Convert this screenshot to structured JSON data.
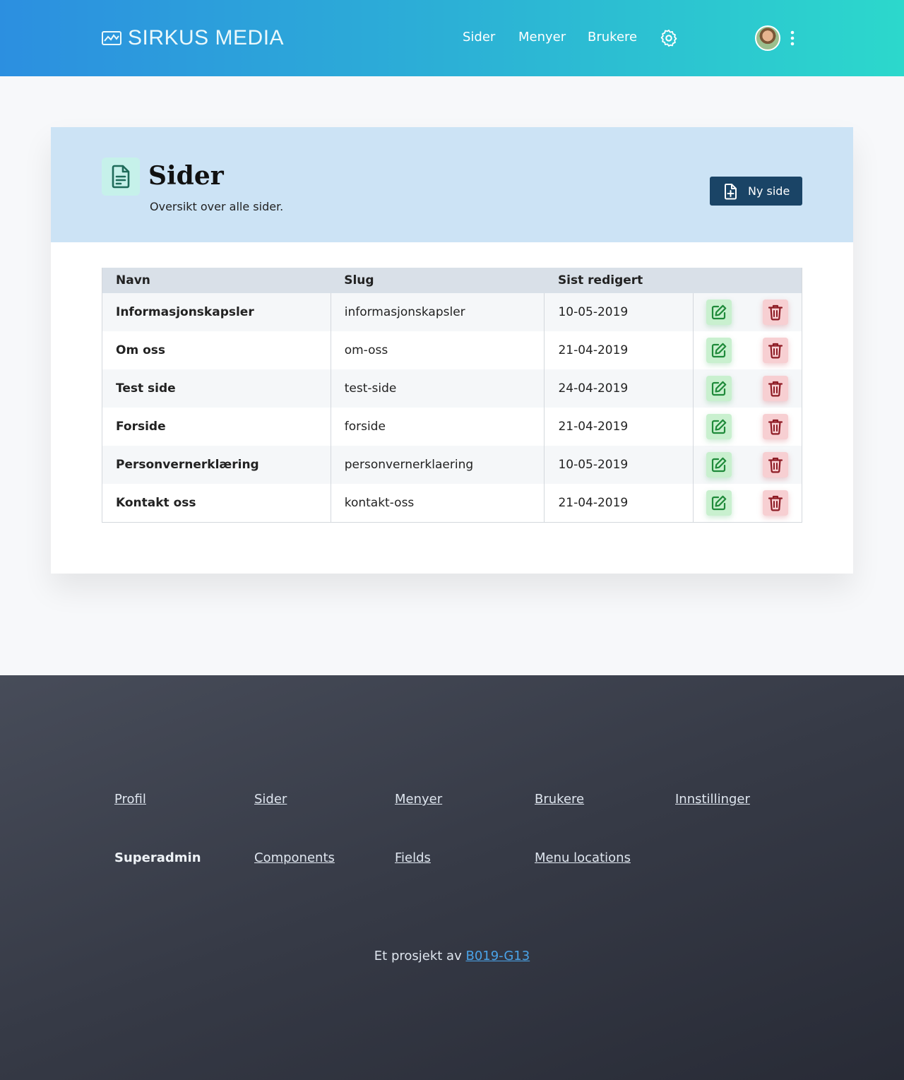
{
  "header": {
    "brand": "SIRKUS MEDIA",
    "nav": [
      {
        "label": "Sider",
        "id": "sider"
      },
      {
        "label": "Menyer",
        "id": "menyer"
      },
      {
        "label": "Brukere",
        "id": "brukere"
      }
    ],
    "icons": [
      "chart-line-icon",
      "gear-icon",
      "avatar",
      "kebab-menu-icon"
    ]
  },
  "page": {
    "title": "Sider",
    "subtitle": "Oversikt over alle sider.",
    "new_button_label": "Ny side"
  },
  "table": {
    "columns": [
      "Navn",
      "Slug",
      "Sist redigert"
    ],
    "rows": [
      {
        "name": "Informasjonskapsler",
        "slug": "informasjonskapsler",
        "edited": "10-05-2019"
      },
      {
        "name": "Om oss",
        "slug": "om-oss",
        "edited": "21-04-2019"
      },
      {
        "name": "Test side",
        "slug": "test-side",
        "edited": "24-04-2019"
      },
      {
        "name": "Forside",
        "slug": "forside",
        "edited": "21-04-2019"
      },
      {
        "name": "Personvernerklæring",
        "slug": "personvernerklaering",
        "edited": "10-05-2019"
      },
      {
        "name": "Kontakt oss",
        "slug": "kontakt-oss",
        "edited": "21-04-2019"
      }
    ]
  },
  "footer": {
    "links_row1": [
      "Profil",
      "Sider",
      "Menyer",
      "Brukere",
      "Innstillinger"
    ],
    "superadmin_label": "Superadmin",
    "links_row2": [
      "Components",
      "Fields",
      "Menu locations"
    ],
    "credit_text": "Et prosjekt av",
    "credit_link": "B019-G13"
  },
  "colors": {
    "header_gradient_start": "#2c8fe0",
    "header_gradient_end": "#2cd8cc",
    "card_head_bg": "#cce3f5",
    "primary_button": "#1a4466",
    "edit_green": "#c9f0cf",
    "delete_red": "#f7cfd2",
    "footer_bg": "#363a46",
    "link_blue": "#4aa3e8"
  }
}
